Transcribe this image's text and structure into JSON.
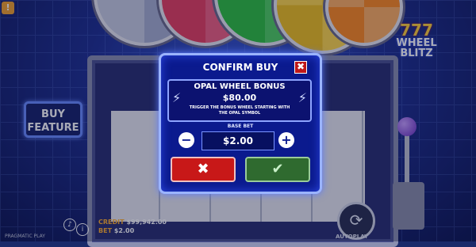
{
  "dialog": {
    "title": "CONFIRM BUY",
    "close_label": "✖",
    "bonus_title": "OPAL WHEEL BONUS",
    "bonus_price": "$80.00",
    "bonus_desc": "TRIGGER THE BONUS WHEEL STARTING WITH THE OPAL SYMBOL",
    "bet_label": "BASE BET",
    "bet_value": "$2.00",
    "decrease_label": "−",
    "increase_label": "+",
    "cancel_label": "✖",
    "confirm_label": "✔"
  },
  "left_panel": {
    "buy_feature_label": "BUY\nFEATURE"
  },
  "logo": {
    "sevens": "777",
    "word": "WHEEL\nBLITZ"
  },
  "status": {
    "credit_key": "CREDIT",
    "credit_value": "$99,942.00",
    "bet_key": "BET",
    "bet_value": "$2.00"
  },
  "footer": {
    "provider": "PRAGMATIC PLAY",
    "autoplay_label": "AUTOPLAY"
  },
  "top_icon_label": "!"
}
